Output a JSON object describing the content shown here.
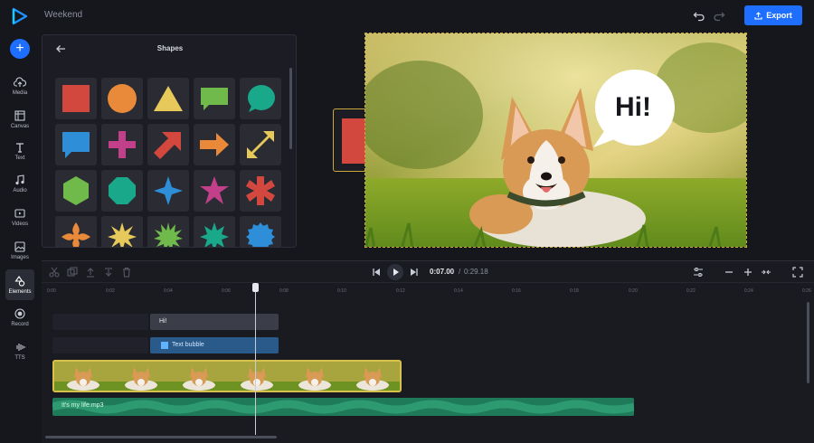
{
  "app": {
    "project_title": "Weekend",
    "export_label": "Export",
    "accent": "#1e6fff"
  },
  "rail": {
    "items": [
      {
        "label": "Media",
        "icon": "cloud-upload-icon"
      },
      {
        "label": "Canvas",
        "icon": "canvas-icon"
      },
      {
        "label": "Text",
        "icon": "text-icon"
      },
      {
        "label": "Audio",
        "icon": "music-note-icon"
      },
      {
        "label": "Videos",
        "icon": "video-icon"
      },
      {
        "label": "Images",
        "icon": "image-icon"
      },
      {
        "label": "Elements",
        "icon": "elements-icon",
        "active": true
      },
      {
        "label": "Record",
        "icon": "record-icon"
      },
      {
        "label": "TTS",
        "icon": "waveform-icon"
      }
    ]
  },
  "panel": {
    "title": "Shapes",
    "shapes": [
      {
        "name": "square",
        "color": "#d2483f"
      },
      {
        "name": "circle",
        "color": "#e98a3a"
      },
      {
        "name": "triangle",
        "color": "#e6c95a"
      },
      {
        "name": "speech-rect",
        "color": "#6fba4a"
      },
      {
        "name": "speech-round",
        "color": "#19a88a"
      },
      {
        "name": "speech-square",
        "color": "#2e8fd8"
      },
      {
        "name": "cross",
        "color": "#c2408a"
      },
      {
        "name": "arrow-up-right",
        "color": "#d2483f"
      },
      {
        "name": "arrow-right",
        "color": "#e98a3a"
      },
      {
        "name": "double-arrow",
        "color": "#e6c95a"
      },
      {
        "name": "hexagon",
        "color": "#6fba4a"
      },
      {
        "name": "octagon",
        "color": "#19a88a"
      },
      {
        "name": "star-4",
        "color": "#2e8fd8"
      },
      {
        "name": "star-5",
        "color": "#c2408a"
      },
      {
        "name": "x-star",
        "color": "#d2483f"
      },
      {
        "name": "flower",
        "color": "#e98a3a"
      },
      {
        "name": "burst-8",
        "color": "#e6c95a"
      },
      {
        "name": "burst-12",
        "color": "#6fba4a"
      },
      {
        "name": "burst-10",
        "color": "#19a88a"
      },
      {
        "name": "seal",
        "color": "#2e8fd8"
      }
    ]
  },
  "canvas": {
    "speech_text": "Hi!"
  },
  "timeline": {
    "current_time": "0:07.00",
    "separator": "/",
    "total_time": "0:29.18",
    "ticks": [
      "0:00",
      "0:02",
      "0:04",
      "0:06",
      "0:08",
      "0:10",
      "0:12",
      "0:14",
      "0:16",
      "0:18",
      "0:20",
      "0:22",
      "0:24",
      "0:26"
    ],
    "clips": {
      "text": "Hi!",
      "bubble": "Text bubble",
      "audio": "It's my life.mp3"
    }
  }
}
